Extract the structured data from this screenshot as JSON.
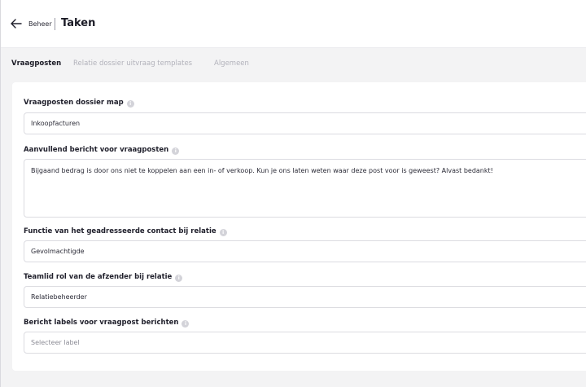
{
  "header": {
    "back_label": "Beheer",
    "title": "Taken"
  },
  "tabs": [
    {
      "label": "Vraagposten",
      "active": true
    },
    {
      "label": "Relatie dossier uitvraag templates",
      "active": false
    },
    {
      "label": "Algemeen",
      "active": false
    }
  ],
  "form": {
    "dossier_map": {
      "label": "Vraagposten dossier map",
      "value": "Inkoopfacturen"
    },
    "aanvullend_bericht": {
      "label": "Aanvullend bericht voor vraagposten",
      "value": "Bijgaand bedrag is door ons niet te koppelen aan een in- of verkoop. Kun je ons laten weten waar deze post voor is geweest? Alvast bedankt!"
    },
    "functie_contact": {
      "label": "Functie van het geadresseerde contact bij relatie",
      "value": "Gevolmachtigde"
    },
    "teamlid_rol": {
      "label": "Teamlid rol van de afzender bij relatie",
      "value": "Relatiebeheerder"
    },
    "bericht_labels": {
      "label": "Bericht labels voor vraagpost berichten",
      "placeholder": "Selecteer label"
    }
  },
  "icons": {
    "back": "arrow-left-icon",
    "info": "info-icon"
  },
  "colors": {
    "page_bg": "#f3f3f4",
    "card_bg": "#ffffff",
    "text": "#1f1f2b",
    "muted": "#b2b2bb",
    "border": "#dcdce1"
  }
}
